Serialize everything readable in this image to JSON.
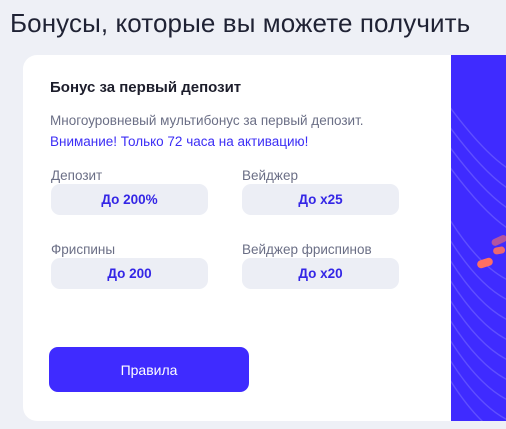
{
  "page": {
    "title": "Бонусы, которые вы можете получить"
  },
  "card": {
    "title": "Бонус за первый депозит",
    "description": "Многоуровневый мультибонус за первый депозит.",
    "warning": "Внимание! Только 72 часа на активацию!",
    "fields": [
      {
        "label": "Депозит",
        "value": "До 200%"
      },
      {
        "label": "Вейджер",
        "value": "До х25"
      },
      {
        "label": "Фриспины",
        "value": "До 200"
      },
      {
        "label": "Вейджер фриспинов",
        "value": "До х20"
      }
    ],
    "rules_button": "Правила"
  },
  "colors": {
    "accent": "#3f2bff",
    "accent_text": "#3426e6",
    "pill_bg": "#eceef5",
    "page_bg": "#eef0f6",
    "decor_coral": "#ff6f61"
  }
}
